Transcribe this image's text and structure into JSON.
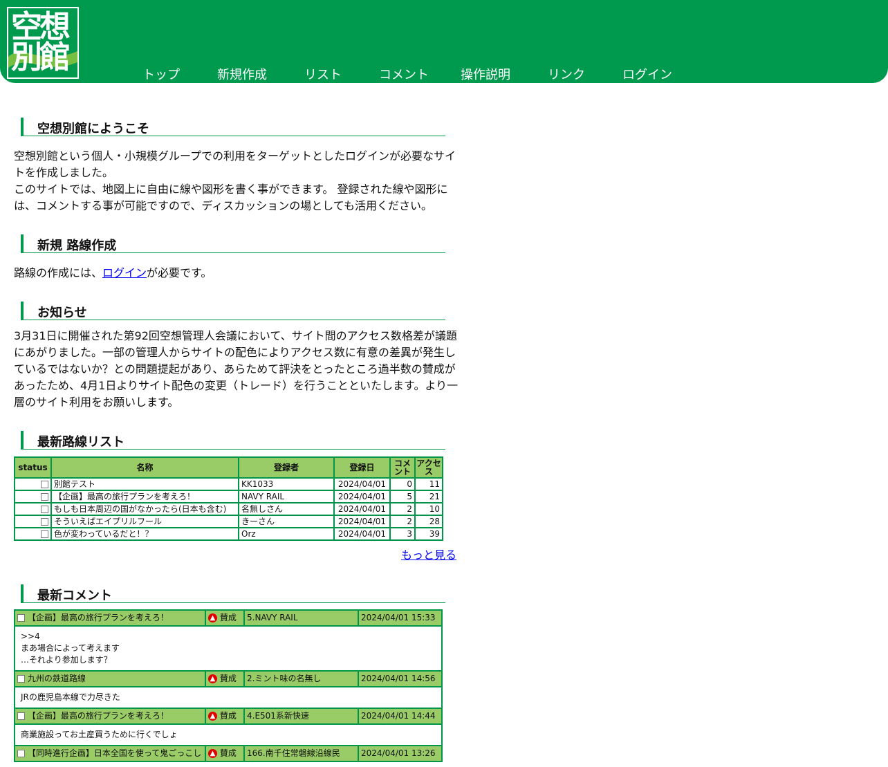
{
  "header": {
    "logo": {
      "line1": "空想",
      "line2": "別館"
    },
    "nav": [
      {
        "label": "トップ"
      },
      {
        "label": "新規作成"
      },
      {
        "label": "リスト"
      },
      {
        "label": "コメント"
      },
      {
        "label": "操作説明"
      },
      {
        "label": "リンク"
      },
      {
        "label": "ログイン"
      }
    ]
  },
  "welcome": {
    "title": "空想別館にようこそ",
    "p1": "空想別館という個人・小規模グループでの利用をターゲットとしたログインが必要なサイトを作成しました。",
    "p2": "このサイトでは、地図上に自由に線や図形を書く事ができます。 登録された線や図形には、コメントする事が可能ですので、ディスカッションの場としても活用ください。"
  },
  "new_route": {
    "title": "新規 路線作成",
    "text_before": "路線の作成には、",
    "login_link": "ログイン",
    "text_after": "が必要です。"
  },
  "notice": {
    "title": "お知らせ",
    "text": "3月31日に開催された第92回空想管理人会議において、サイト間のアクセス数格差が議題にあがりました。一部の管理人からサイトの配色によりアクセス数に有意の差異が発生しているではないか？との問題提起があり、あらためて評決をとったところ過半数の賛成があったため、4月1日よりサイト配色の変更（トレード）を行うことといたします。より一層のサイト利用をお願いします。"
  },
  "route_list": {
    "title": "最新路線リスト",
    "columns": [
      "status",
      "名称",
      "登録者",
      "登録日",
      "コメント",
      "アクセス"
    ],
    "rows": [
      {
        "name": "別館テスト",
        "author": "KK1033",
        "date": "2024/04/01",
        "comments": "0",
        "access": "11"
      },
      {
        "name": "【企画】最高の旅行プランを考えろ！",
        "author": "NAVY RAIL",
        "date": "2024/04/01",
        "comments": "5",
        "access": "21"
      },
      {
        "name": "もしも日本周辺の国がなかったら(日本も含む)",
        "author": "名無しさん",
        "date": "2024/04/01",
        "comments": "2",
        "access": "10"
      },
      {
        "name": "そういえばエイプリルフール",
        "author": "きーさん",
        "date": "2024/04/01",
        "comments": "2",
        "access": "28"
      },
      {
        "name": "色が変わっているだと！？",
        "author": "Orz",
        "date": "2024/04/01",
        "comments": "3",
        "access": "39"
      }
    ],
    "more_link": "もっと見る"
  },
  "latest_comments": {
    "title": "最新コメント",
    "vote_label": "賛成",
    "items": [
      {
        "route": "【企画】最高の旅行プランを考えろ！",
        "user": "5.NAVY RAIL",
        "datetime": "2024/04/01 15:33",
        "body": [
          ">>4",
          "まあ場合によって考えます",
          "…それより参加します？"
        ]
      },
      {
        "route": "九州の鉄道路線",
        "user": "2.ミント味の名無し",
        "datetime": "2024/04/01 14:56",
        "body": [
          "JRの鹿児島本線で力尽きた"
        ]
      },
      {
        "route": "【企画】最高の旅行プランを考えろ！",
        "user": "4.E501系新快速",
        "datetime": "2024/04/01 14:44",
        "body": [
          "商業施設ってお土産買うために行くでしょ"
        ]
      },
      {
        "route": "【同時進行企画】日本全国を使って鬼ごっこし",
        "user": "166.南千住常磐線沿線民",
        "datetime": "2024/04/01 13:26",
        "body": []
      }
    ]
  },
  "colors": {
    "brand": "#009a4e",
    "table_header": "#99cc66",
    "vote_icon": "#e00000"
  }
}
